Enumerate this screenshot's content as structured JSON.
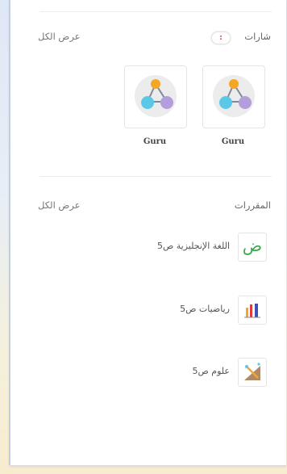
{
  "badges": {
    "title": "شارات",
    "count": ":",
    "view_all": "عرض الكل",
    "items": [
      {
        "name": "Guru"
      },
      {
        "name": "Guru"
      }
    ]
  },
  "courses": {
    "title": "المقررات",
    "view_all": "عرض الكل",
    "items": [
      {
        "name": "اللغة الإنجليزية ص5",
        "icon": "arabic-letter-icon"
      },
      {
        "name": "رياضيات ص5",
        "icon": "math-bars-icon"
      },
      {
        "name": "علوم ص5",
        "icon": "science-icon"
      }
    ]
  },
  "colors": {
    "accent_orange": "#f5a623",
    "badge_node_blue": "#5bc8e8",
    "badge_node_purple": "#b39ddb",
    "badge_red": "#e53935"
  }
}
